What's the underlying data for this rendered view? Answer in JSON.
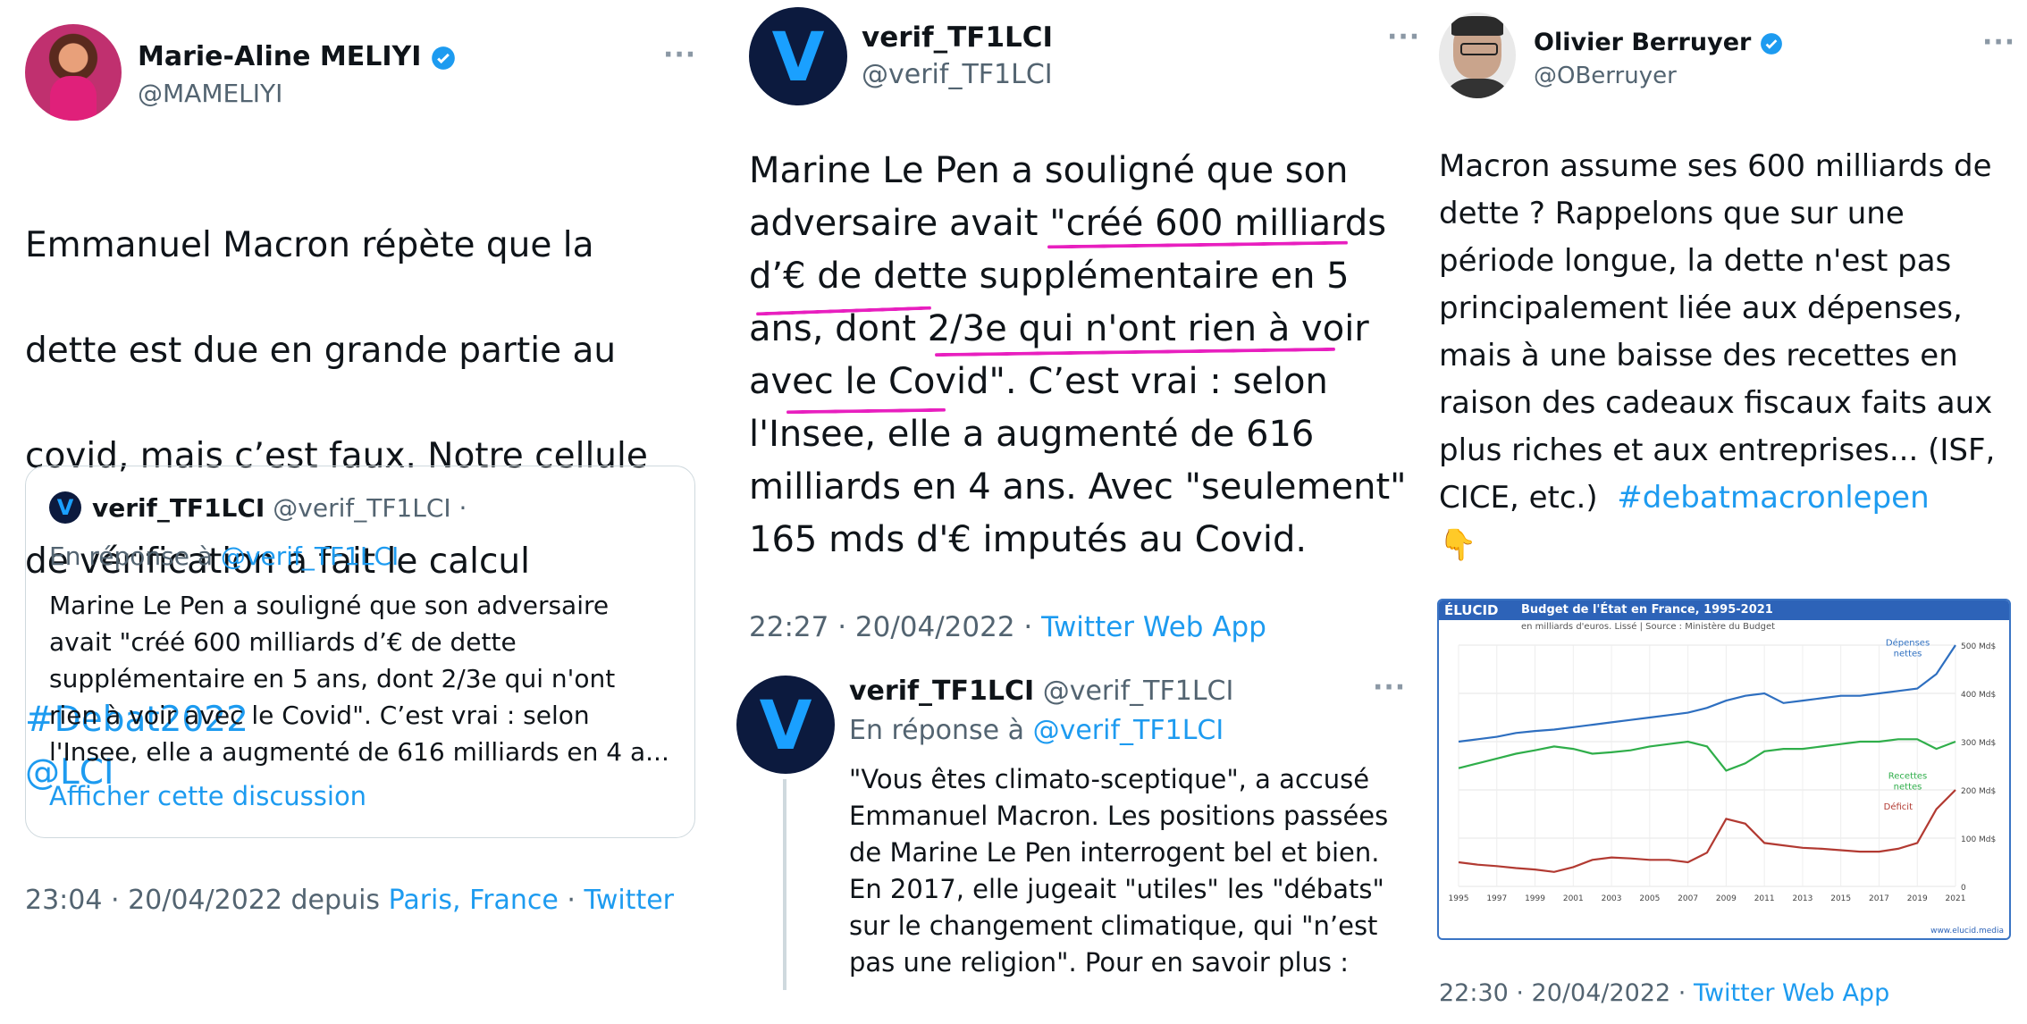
{
  "col1": {
    "author": {
      "name": "Marie-Aline MELIYI",
      "handle": "@MAMELIYI"
    },
    "more": "···",
    "body_lines": [
      "Emmanuel Macron répète que la",
      "dette est due en grande partie au",
      "covid, mais c’est faux. Notre cellule",
      "de vérification a fait le calcul"
    ],
    "hashtag": "#Debat2022",
    "mention": "@LCI",
    "quote": {
      "name": "verif_TF1LCI",
      "handle": "@verif_TF1LCI ·",
      "reply_prefix": "En réponse à ",
      "reply_handle": "@verif_TF1LCI",
      "lines": [
        "Marine Le Pen a souligné que son adversaire",
        "avait \"créé 600 milliards d’€ de dette",
        "supplémentaire en 5 ans, dont 2/3e qui n'ont",
        "rien à voir avec le Covid\". C’est vrai : selon",
        "l'Insee, elle a augmenté de 616 milliards en 4 a..."
      ],
      "show_thread": "Afficher cette discussion"
    },
    "footer": {
      "time": "23:04 · 20/04/2022 depuis ",
      "place": "Paris, France",
      "sep": " · ",
      "app": "Twitter"
    }
  },
  "col2": {
    "author": {
      "name": "verif_TF1LCI",
      "handle": "@verif_TF1LCI",
      "logo": "V"
    },
    "more": "···",
    "body_lines": [
      "Marine Le Pen a souligné que son",
      "adversaire avait \"créé 600 milliards",
      "d’€ de dette supplémentaire en 5",
      "ans, dont 2/3e qui n'ont rien à voir",
      "avec le Covid\". C’est vrai : selon",
      "l'Insee, elle a augmenté de 616",
      "milliards en 4 ans. Avec \"seulement\"",
      "165 mds d'€ imputés au Covid."
    ],
    "footer": {
      "time": "22:27 · 20/04/2022 · ",
      "app": "Twitter Web App"
    },
    "reply": {
      "name": "verif_TF1LCI",
      "handle": "@verif_TF1LCI",
      "more": "···",
      "reply_prefix": "En réponse à ",
      "reply_handle": "@verif_TF1LCI",
      "lines": [
        "\"Vous êtes climato-sceptique\", a accusé",
        "Emmanuel Macron. Les positions passées",
        "de Marine Le Pen interrogent bel et bien.",
        "En 2017, elle jugeait \"utiles\" les \"débats\"",
        "sur le changement climatique, qui \"n’est",
        "pas une religion\". Pour en savoir plus :"
      ]
    }
  },
  "col3": {
    "author": {
      "name": "Olivier Berruyer",
      "handle": "@OBerruyer"
    },
    "more": "···",
    "body_lines": [
      "Macron assume ses 600 milliards de",
      "dette ? Rappelons que sur une",
      "période longue, la dette n'est pas",
      "principalement liée aux dépenses,",
      "mais à une baisse des recettes en",
      "raison des cadeaux fiscaux faits aux",
      "plus riches et aux entreprises... (ISF,",
      "CICE, etc.)"
    ],
    "hashtag": "#debatmacronlepen",
    "emoji": "👇",
    "footer": {
      "time": "22:30 · 20/04/2022 · ",
      "app": "Twitter Web App"
    }
  },
  "chart_data": {
    "type": "line",
    "brand": "ÉLUCID",
    "title": "Budget de l'État en France, 1995-2021",
    "subtitle": "en milliards d'euros. Lissé  |  Source : Ministère du Budget",
    "footer_url": "www.elucid.media",
    "x": [
      1995,
      1996,
      1997,
      1998,
      1999,
      2000,
      2001,
      2002,
      2003,
      2004,
      2005,
      2006,
      2007,
      2008,
      2009,
      2010,
      2011,
      2012,
      2013,
      2014,
      2015,
      2016,
      2017,
      2018,
      2019,
      2020,
      2021
    ],
    "xticks": [
      "1995",
      "1997",
      "1999",
      "2001",
      "2003",
      "2005",
      "2007",
      "2009",
      "2011",
      "2013",
      "2015",
      "2017",
      "2019",
      "2021"
    ],
    "yticks": [
      "0",
      "100 Md$",
      "200 Md$",
      "300 Md$",
      "400 Md$",
      "500 Md$"
    ],
    "ylim": [
      0,
      500
    ],
    "series": [
      {
        "name": "Dépenses nettes",
        "color": "#2e6fc0",
        "values": [
          300,
          305,
          310,
          318,
          322,
          325,
          330,
          335,
          340,
          345,
          350,
          355,
          360,
          370,
          385,
          395,
          400,
          380,
          385,
          390,
          395,
          395,
          400,
          405,
          410,
          440,
          500
        ]
      },
      {
        "name": "Recettes nettes",
        "color": "#2fae4a",
        "values": [
          245,
          255,
          265,
          275,
          282,
          290,
          285,
          275,
          278,
          282,
          290,
          295,
          300,
          290,
          240,
          255,
          280,
          285,
          285,
          290,
          295,
          300,
          300,
          305,
          305,
          285,
          300
        ]
      },
      {
        "name": "Déficit",
        "color": "#b23a32",
        "values": [
          50,
          45,
          42,
          38,
          35,
          30,
          40,
          55,
          60,
          58,
          55,
          55,
          50,
          70,
          140,
          130,
          90,
          85,
          80,
          78,
          75,
          72,
          72,
          78,
          90,
          160,
          200
        ]
      }
    ]
  }
}
